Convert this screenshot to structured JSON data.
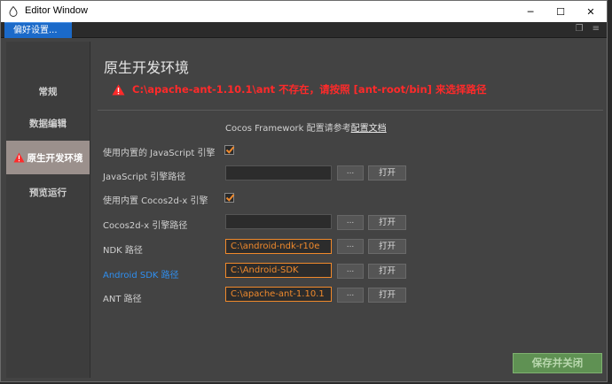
{
  "window": {
    "title": "Editor Window",
    "controls": {
      "minimize": "─",
      "maximize": "☐",
      "close": "✕"
    }
  },
  "tabbar": {
    "tab_label": "偏好设置...",
    "tool_icons": [
      "❐",
      "≡"
    ]
  },
  "sidebar": {
    "items": [
      {
        "label": "常规"
      },
      {
        "label": "数据编辑"
      },
      {
        "label": "原生开发环境"
      },
      {
        "label": "预览运行"
      }
    ]
  },
  "main": {
    "heading": "原生开发环境",
    "warning": "C:\\apache-ant-1.10.1\\ant 不存在，请按照 [ant-root/bin] 来选择路径",
    "framework_note_prefix": "Cocos Framework 配置请参考",
    "framework_note_link": "配置文档",
    "rows": {
      "use_builtin_js_label": "使用内置的 JavaScript 引擎",
      "js_path_label": "JavaScript 引擎路径",
      "use_builtin_cocos_label": "使用内置 Cocos2d-x 引擎",
      "cocos_path_label": "Cocos2d-x 引擎路径",
      "ndk_label": "NDK 路径",
      "ndk_value": "C:\\android-ndk-r10e",
      "sdk_label": "Android SDK 路径",
      "sdk_value": "C:\\Android-SDK",
      "ant_label": "ANT 路径",
      "ant_value": "C:\\apache-ant-1.10.1"
    },
    "dots_label": "...",
    "open_label": "打开",
    "save_label": "保存并关闭"
  },
  "colors": {
    "accent_tab": "#1b6ac9",
    "warning": "#ff2a2a",
    "path_text": "#f08a2d",
    "save_bg": "#5f9153",
    "sdk_label": "#2f8ff0"
  }
}
